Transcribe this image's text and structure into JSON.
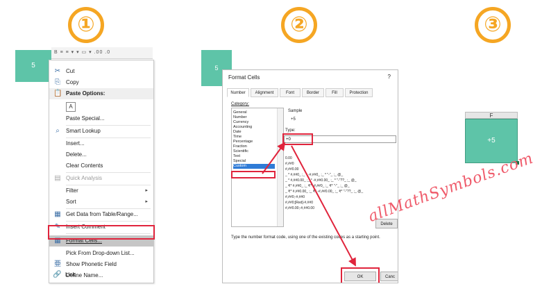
{
  "steps": [
    "①",
    "②",
    "③"
  ],
  "panel1": {
    "cell_value": "5",
    "ribbon_glyphs": "B ≡ ≡ ▾ ▾ ▭ ▾ .00 .0",
    "menu_items": [
      {
        "label": "Cut",
        "icon": "✂",
        "icon_name": "scissors-icon"
      },
      {
        "label": "Copy",
        "icon": "⎘",
        "icon_name": "copy-icon"
      },
      {
        "label": "Paste Options:",
        "icon": "📋",
        "icon_name": "clipboard-icon"
      },
      {
        "label": "Paste Special...",
        "icon": "",
        "icon_name": ""
      },
      {
        "label": "Smart Lookup",
        "icon": "⌕",
        "icon_name": "search-icon"
      },
      {
        "label": "Insert...",
        "icon": "",
        "icon_name": ""
      },
      {
        "label": "Delete...",
        "icon": "",
        "icon_name": ""
      },
      {
        "label": "Clear Contents",
        "icon": "",
        "icon_name": ""
      },
      {
        "label": "Quick Analysis",
        "icon": "▤",
        "icon_name": "quick-analysis-icon"
      },
      {
        "label": "Filter",
        "icon": "",
        "icon_name": ""
      },
      {
        "label": "Sort",
        "icon": "",
        "icon_name": ""
      },
      {
        "label": "Get Data from Table/Range...",
        "icon": "▦",
        "icon_name": "table-icon"
      },
      {
        "label": "Insert Comment",
        "icon": "✎",
        "icon_name": "comment-icon"
      },
      {
        "label": "Format Cells...",
        "icon": "▦",
        "icon_name": "format-cells-icon"
      },
      {
        "label": "Pick From Drop-down List...",
        "icon": "",
        "icon_name": ""
      },
      {
        "label": "Show Phonetic Field",
        "icon": "亜",
        "icon_name": "phonetic-icon"
      },
      {
        "label": "Define Name...",
        "icon": "",
        "icon_name": ""
      },
      {
        "label": "Link",
        "icon": "🔗",
        "icon_name": "link-icon"
      }
    ],
    "paste_icon_letter": "A",
    "submenu_arrow": "▸"
  },
  "panel2": {
    "cell_value": "5",
    "dialog_title": "Format Cells",
    "help": "?",
    "tabs": [
      "Number",
      "Alignment",
      "Font",
      "Border",
      "Fill",
      "Protection"
    ],
    "category_label": "Category:",
    "categories": [
      "General",
      "Number",
      "Currency",
      "Accounting",
      "Date",
      "Time",
      "Percentage",
      "Fraction",
      "Scientific",
      "Text",
      "Special",
      "Custom"
    ],
    "selected_category": "Custom",
    "sample_label": "Sample",
    "sample_value": "+5",
    "type_label": "Type:",
    "type_value": "+0",
    "format_codes": [
      "0.00",
      "#,##0",
      "#,##0.00",
      "_ * #,##0_ ;_ * -#,##0_ ;_ * \"-\"_ ;_ @_",
      "_ * #,##0.00_ ;_ * -#,##0.00_ ;_ * \"-\"??_ ;_ @_",
      "_ ₹* #,##0_ ;_ ₹* -#,##0_ ;_ ₹* \"-\"_ ;_ @_",
      "_ ₹* #,##0.00_ ;_ ₹* -#,##0.00_ ;_ ₹* \"-\"??_ ;_ @_",
      "#,##0;-#,##0",
      "#,##0;[Red]-#,##0",
      "#,##0.00;-#,##0.00"
    ],
    "delete_label": "Delete",
    "hint": "Type the number format code, using one of the existing codes as a starting point.",
    "ok_label": "OK",
    "cancel_label": "Canc"
  },
  "panel3": {
    "column_header": "F",
    "cell_value": "+5"
  },
  "watermark": "allMathSymbols.com",
  "colors": {
    "accent": "#f5a623",
    "cell": "#5ec4a8",
    "highlight": "#e0243c",
    "watermark": "#ef5a6a"
  }
}
